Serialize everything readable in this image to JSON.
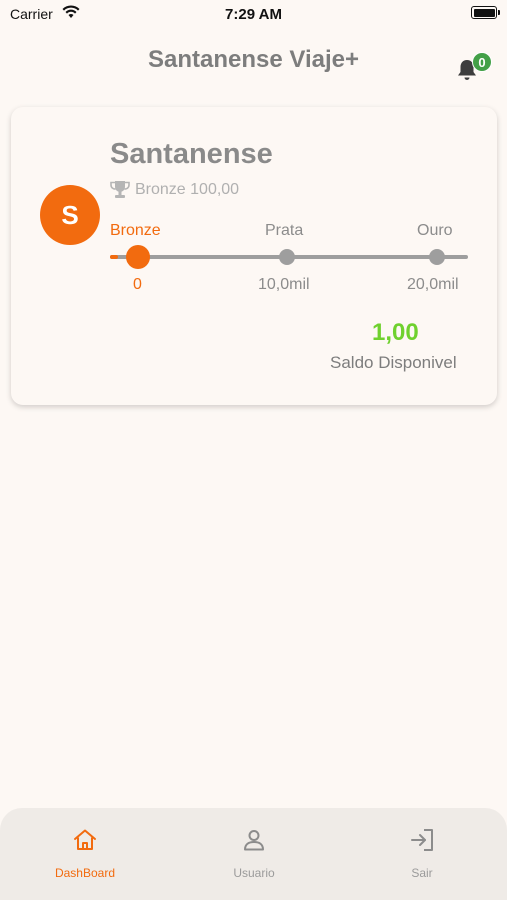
{
  "status_bar": {
    "carrier": "Carrier",
    "time": "7:29 AM"
  },
  "header": {
    "title": "Santanense Viaje+",
    "notification_count": "0"
  },
  "profile": {
    "avatar_letter": "S",
    "name": "Santanense",
    "tier_text": "Bronze 100,00",
    "levels": [
      {
        "label": "Bronze",
        "value": "0"
      },
      {
        "label": "Prata",
        "value": "10,0mil"
      },
      {
        "label": "Ouro",
        "value": "20,0mil"
      }
    ],
    "progress_fraction": 0.0,
    "balance": "1,00",
    "balance_label": "Saldo Disponivel"
  },
  "bottom_nav": {
    "items": [
      {
        "label": "DashBoard",
        "icon": "home-icon",
        "active": true
      },
      {
        "label": "Usuario",
        "icon": "user-icon",
        "active": false
      },
      {
        "label": "Sair",
        "icon": "logout-icon",
        "active": false
      }
    ]
  },
  "colors": {
    "accent": "#f26b0f",
    "balance": "#6fd12e",
    "badge": "#43a047",
    "background": "#fdf8f4"
  }
}
